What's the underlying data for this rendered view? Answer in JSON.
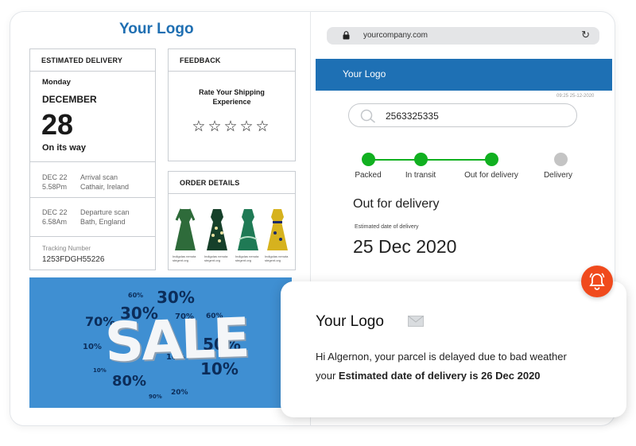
{
  "left": {
    "logo": "Your Logo",
    "estimated_delivery": {
      "heading": "ESTIMATED DELIVERY",
      "day": "Monday",
      "month": "DECEMBER",
      "date": "28",
      "status": "On its way",
      "scans": [
        {
          "date": "DEC 22",
          "time": "5.58Pm",
          "event": "Arrival scan",
          "place": "Cathair, Ireland"
        },
        {
          "date": "DEC 22",
          "time": "6.58Am",
          "event": "Departure scan",
          "place": "Bath, England"
        }
      ],
      "tracking_label": "Tracking Number",
      "tracking_number": "1253FDGH55226"
    },
    "feedback": {
      "heading": "FEEDBACK",
      "prompt_line1": "Rate Your Shipping",
      "prompt_line2": "Experience",
      "stars": "☆☆☆☆☆"
    },
    "order_details": {
      "heading": "ORDER DETAILS",
      "items": [
        {
          "color": "#2e6b3a",
          "caption": "Indigolas nenuta stegent.org"
        },
        {
          "color": "#16402a",
          "caption": "Indigolas nenuta stegent.org"
        },
        {
          "color": "#1f7a55",
          "caption": "Indigolas nenuta stegent.org"
        },
        {
          "color": "#d6b21e",
          "caption": "Indigolas nenuta stegent.org"
        }
      ]
    },
    "sale_banner": {
      "word": "SALE",
      "percents": [
        "60%",
        "30%",
        "30%",
        "70%",
        "70%",
        "60%",
        "10%",
        "50%",
        "10%",
        "80%",
        "90%",
        "20%",
        "10%",
        "10%"
      ]
    }
  },
  "browser": {
    "url": "yourcompany.com",
    "header_logo": "Your Logo",
    "timestamp": "09:25 25-12-2020",
    "search_value": "2563325335",
    "steps": [
      {
        "label": "Packed",
        "state": "done"
      },
      {
        "label": "In transit",
        "state": "done"
      },
      {
        "label": "Out for delivery",
        "state": "done"
      },
      {
        "label": "Delivery",
        "state": "pending"
      }
    ],
    "status_title": "Out for delivery",
    "estimated_label": "Estimated date of delivery",
    "estimated_date": "25 Dec 2020"
  },
  "notification": {
    "logo": "Your Logo",
    "message_line1": "Hi Algernon, your parcel is delayed due to bad weather",
    "message_prefix": "your ",
    "message_bold": "Estimated date of delivery is 26 Dec 2020"
  },
  "colors": {
    "brand_blue": "#1e70b4",
    "logo_blue": "#1f6fb2",
    "progress_green": "#11b020",
    "pending_gray": "#c4c4c4",
    "bell_orange": "#f04a1d",
    "sale_bg": "#3f8fd2"
  }
}
